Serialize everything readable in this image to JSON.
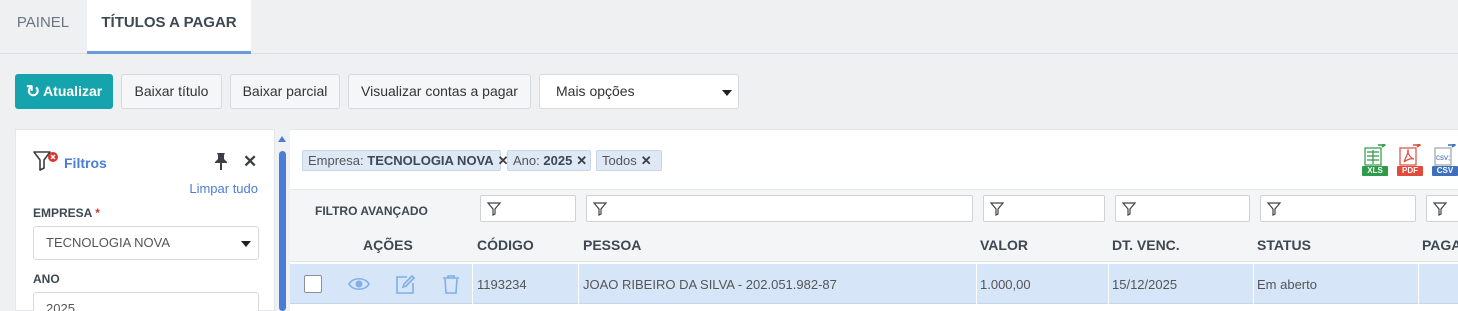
{
  "tabs": [
    {
      "label": "PAINEL"
    },
    {
      "label": "TÍTULOS A PAGAR"
    }
  ],
  "toolbar": {
    "refresh_label": "Atualizar",
    "baixar_titulo_label": "Baixar título",
    "baixar_parcial_label": "Baixar parcial",
    "visualizar_label": "Visualizar contas a pagar",
    "mais_opcoes_value": "Mais opções"
  },
  "filters": {
    "title": "Filtros",
    "clear_all": "Limpar tudo",
    "empresa_label": "EMPRESA",
    "required_mark": "*",
    "empresa_value": "TECNOLOGIA NOVA",
    "ano_label": "ANO",
    "ano_value": "2025"
  },
  "chips": [
    {
      "prefix": "Empresa:",
      "value": "TECNOLOGIA NOVA",
      "remove": "✕"
    },
    {
      "prefix": "Ano:",
      "value": "2025",
      "remove": "✕"
    },
    {
      "prefix": "Todos",
      "value": "",
      "remove": "✕"
    }
  ],
  "export": {
    "xls": "XLS",
    "pdf": "PDF",
    "csv": "CSV",
    "csv_glyph": "csv;"
  },
  "advanced_filter_label": "FILTRO AVANÇADO",
  "columns": [
    "AÇÕES",
    "CÓDIGO",
    "PESSOA",
    "VALOR",
    "DT. VENC.",
    "STATUS",
    "PAGA"
  ],
  "rows": [
    {
      "codigo": "1193234",
      "pessoa": "JOAO RIBEIRO DA SILVA - 202.051.982-87",
      "valor": "1.000,00",
      "vencimento": "15/12/2025",
      "status": "Em aberto"
    }
  ],
  "icons": {
    "refresh": "refresh-icon",
    "filter": "filter-icon",
    "pin": "pin-icon",
    "close": "close-icon",
    "view": "eye-icon",
    "edit": "edit-icon",
    "delete": "trash-icon"
  },
  "colors": {
    "primary": "#15a3ad",
    "accent_blue": "#4a7ed6",
    "selected_row": "#d6e5f7",
    "required": "#d9342b"
  }
}
